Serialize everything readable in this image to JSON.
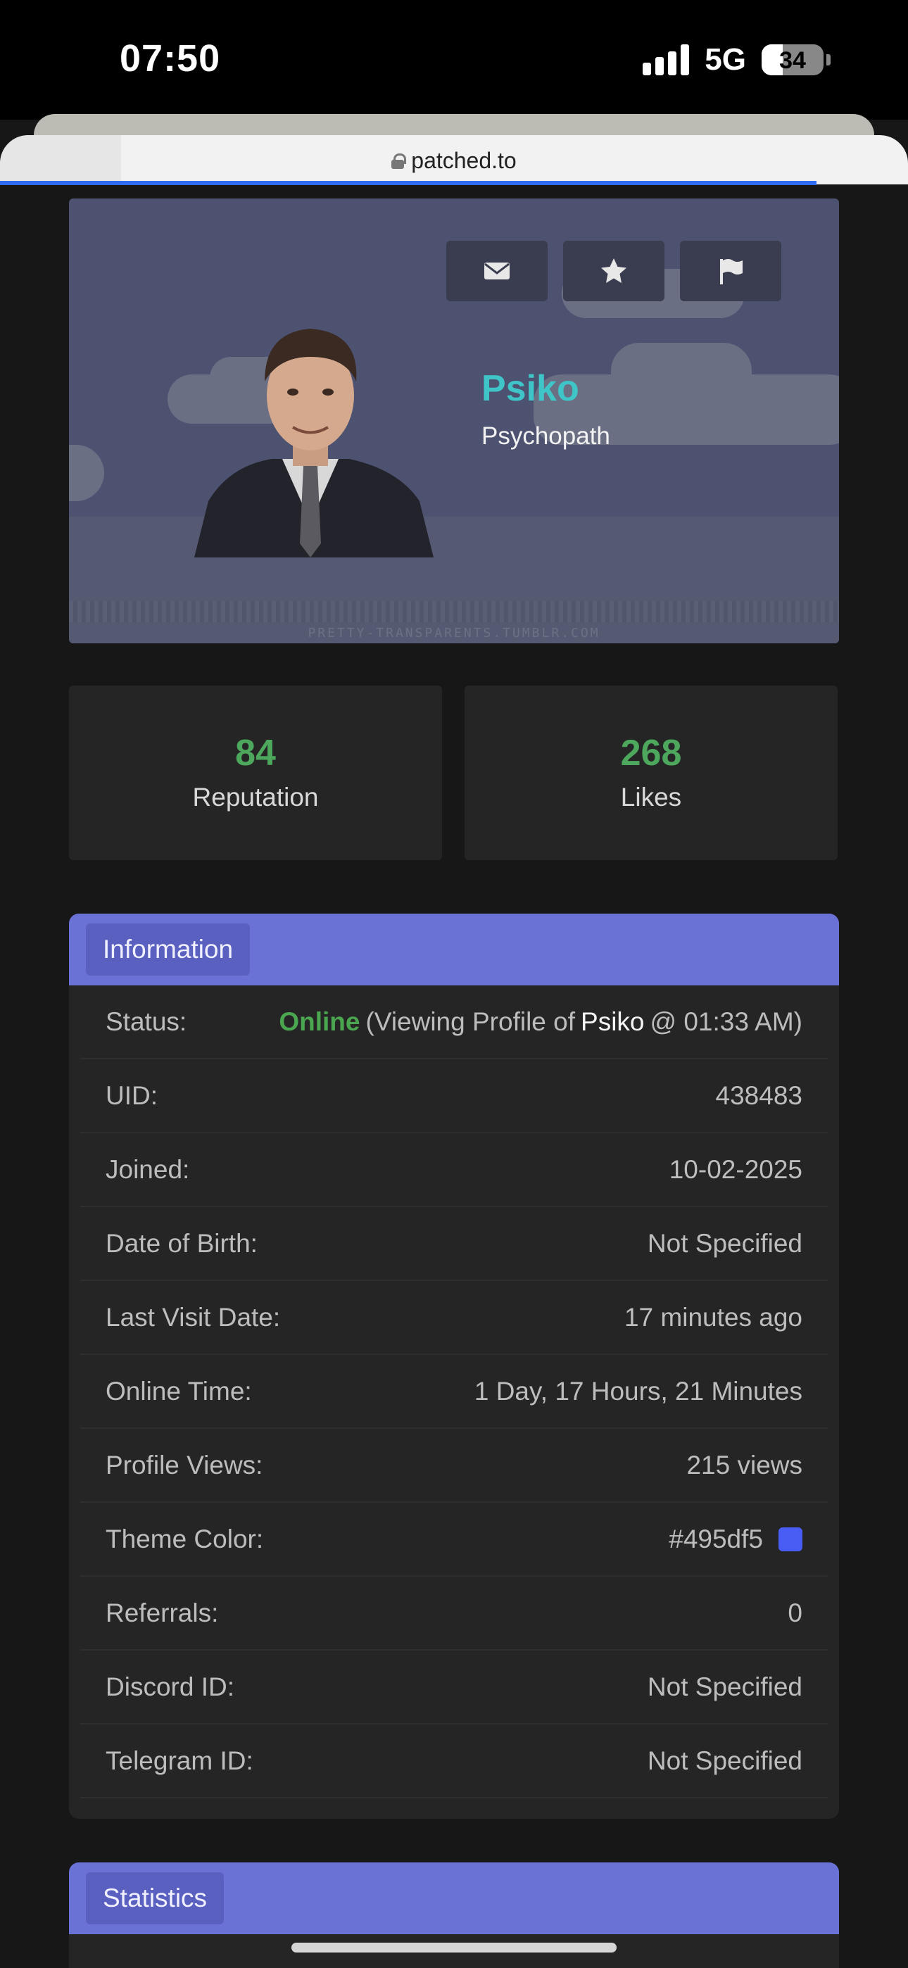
{
  "status_bar": {
    "time": "07:50",
    "network": "5G",
    "battery": "34"
  },
  "browser": {
    "url": "patched.to"
  },
  "profile": {
    "username": "Psiko",
    "user_title": "Psychopath",
    "username_color": "#3fc4c8",
    "banner_watermark": "PRETTY-TRANSPARENTS.TUMBLR.COM",
    "actions": [
      "mail-icon",
      "star-icon",
      "flag-icon"
    ]
  },
  "stats": {
    "reputation": {
      "value": "84",
      "label": "Reputation"
    },
    "likes": {
      "value": "268",
      "label": "Likes"
    }
  },
  "information": {
    "heading": "Information",
    "status_label": "Status:",
    "status_online": "Online",
    "status_activity_prefix": "(Viewing Profile of",
    "status_activity_user": "Psiko",
    "status_activity_suffix": "@ 01:33 AM)",
    "rows": [
      {
        "label": "UID:",
        "value": "438483"
      },
      {
        "label": "Joined:",
        "value": "10-02-2025"
      },
      {
        "label": "Date of Birth:",
        "value": "Not Specified"
      },
      {
        "label": "Last Visit Date:",
        "value": "17 minutes ago"
      },
      {
        "label": "Online Time:",
        "value": "1 Day, 17 Hours, 21 Minutes"
      },
      {
        "label": "Profile Views:",
        "value": "215 views"
      }
    ],
    "theme_color_label": "Theme Color:",
    "theme_color_value": "#495df5",
    "referrals_label": "Referrals:",
    "referrals_value": "0",
    "discord_label": "Discord ID:",
    "discord_value": "Not Specified",
    "telegram_label": "Telegram ID:",
    "telegram_value": "Not Specified"
  },
  "statistics": {
    "heading": "Statistics"
  },
  "colors": {
    "accent_header": "#6b72d6",
    "online_green": "#4aa64f",
    "stat_green": "#4da85e",
    "progress_blue": "#2f6cf2"
  }
}
